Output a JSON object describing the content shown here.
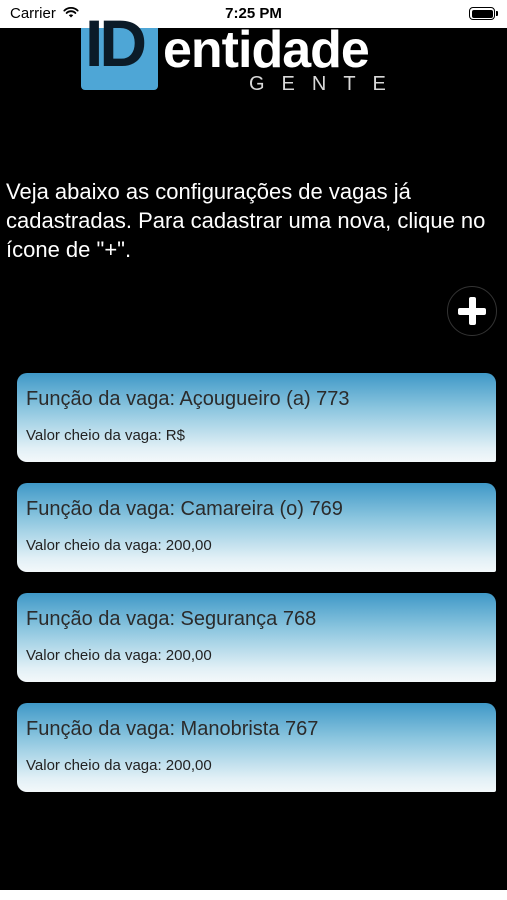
{
  "status_bar": {
    "carrier": "Carrier",
    "time": "7:25 PM"
  },
  "logo": {
    "mark": "ID",
    "word": "entidade",
    "sub": "GENTE"
  },
  "intro_text": "Veja abaixo as configurações de vagas já cadastradas. Para cadastrar uma nova, clique no ícone de \"+\".",
  "icons": {
    "add": "plus-circle-icon"
  },
  "jobs": [
    {
      "title": "Função da vaga: Açougueiro (a) 773",
      "value": "Valor cheio da vaga: R$"
    },
    {
      "title": "Função da vaga: Camareira (o) 769",
      "value": "Valor cheio da vaga: 200,00"
    },
    {
      "title": "Função da vaga: Segurança 768",
      "value": "Valor cheio da vaga: 200,00"
    },
    {
      "title": "Função da vaga: Manobrista 767",
      "value": "Valor cheio da vaga: 200,00"
    }
  ],
  "colors": {
    "background": "#000000",
    "brand_blue": "#4ea6d6",
    "card_top": "#3f98c7",
    "card_bottom": "#f3f8fa"
  }
}
